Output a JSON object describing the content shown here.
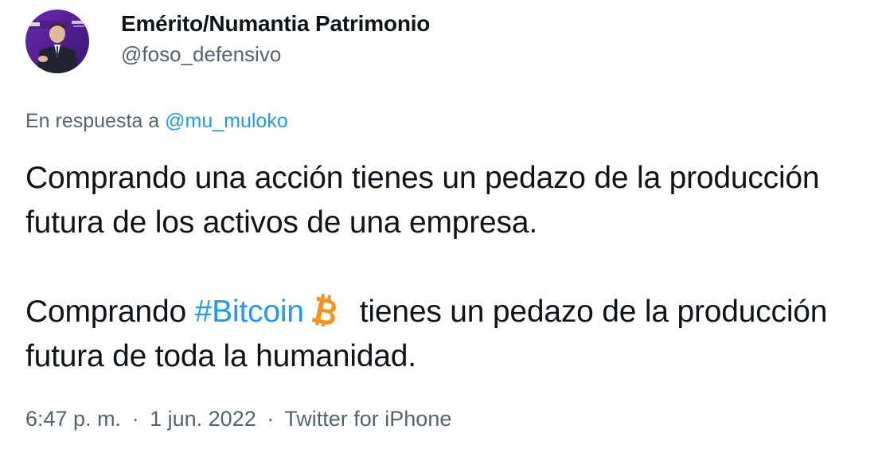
{
  "author": {
    "display_name": "Emérito/Numantia Patrimonio",
    "handle": "@foso_defensivo"
  },
  "reply": {
    "prefix": "En respuesta a",
    "to_handle": "@mu_muloko"
  },
  "body": {
    "paragraph1": "Comprando una acción tienes un pedazo de la producción futura de los activos de una empresa.",
    "p2_before": "Comprando ",
    "hashtag": "#Bitcoin",
    "emoji": "bitcoin-emoji",
    "p2_after": "tienes un pedazo de la producción futura de toda la humanidad."
  },
  "meta": {
    "time": "6:47 p. m.",
    "separator": "·",
    "date": "1 jun. 2022",
    "source": "Twitter for iPhone"
  },
  "colors": {
    "text": "#0f1419",
    "secondary": "#536471",
    "link": "#1d9bf0",
    "bitcoin": "#f7931a"
  }
}
